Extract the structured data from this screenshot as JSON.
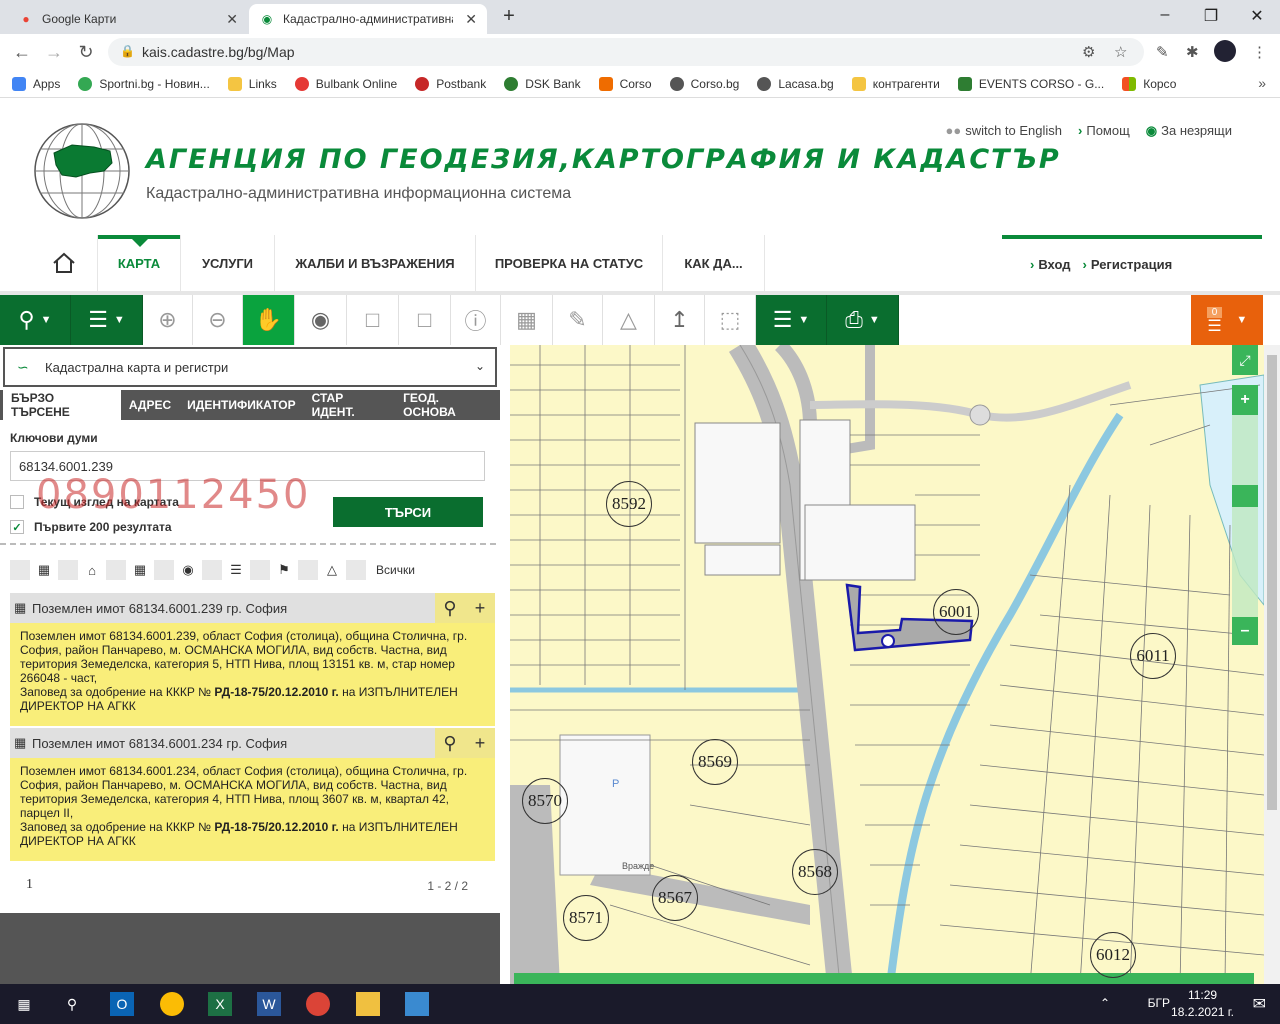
{
  "browser": {
    "tabs": [
      {
        "title": "Google Карти"
      },
      {
        "title": "Кадастрално-административна"
      }
    ],
    "url": "kais.cadastre.bg/bg/Map",
    "bookmarks": [
      {
        "label": "Apps",
        "color": "#4285f4"
      },
      {
        "label": "Sportni.bg - Новин...",
        "color": "#34a853"
      },
      {
        "label": "Links",
        "color": "#f4c542"
      },
      {
        "label": "Bulbank Online",
        "color": "#e53935"
      },
      {
        "label": "Postbank",
        "color": "#c62828"
      },
      {
        "label": "DSK Bank",
        "color": "#2e7d32"
      },
      {
        "label": "Corso",
        "color": "#ef6c00"
      },
      {
        "label": "Corso.bg",
        "color": "#555555"
      },
      {
        "label": "Lacasa.bg",
        "color": "#555555"
      },
      {
        "label": "контрагенти",
        "color": "#f4c542"
      },
      {
        "label": "EVENTS CORSO - G...",
        "color": "#2e7d32"
      },
      {
        "label": "Корсо",
        "color": "#f25022"
      }
    ]
  },
  "header": {
    "title": "АГЕНЦИЯ ПО ГЕОДЕЗИЯ,КАРТОГРАФИЯ И КАДАСТЪР",
    "subtitle": "Кадастрално-административна информационна система",
    "links": {
      "english": "switch to English",
      "help": "Помощ",
      "blind": "За незрящи"
    }
  },
  "menu": {
    "items": [
      "КАРТА",
      "УСЛУГИ",
      "ЖАЛБИ И ВЪЗРАЖЕНИЯ",
      "ПРОВЕРКА НА СТАТУС",
      "КАК ДА..."
    ],
    "login": "Вход",
    "register": "Регистрация"
  },
  "cart": {
    "count": "0"
  },
  "panel": {
    "layer": "Кадастрална карта и регистри",
    "tabs": [
      "БЪРЗО ТЪРСЕНЕ",
      "АДРЕС",
      "ИДЕНТИФИКАТОР",
      "СТАР ИДЕНТ.",
      "ГЕОД. ОСНОВА"
    ],
    "keywords_label": "Ключови думи",
    "keywords_value": "68134.6001.239",
    "watermark": "0890112450",
    "cb_current_view": "Текущ изглед на картата",
    "cb_first200": "Първите 200 резултата",
    "search_button": "ТЪРСИ",
    "filter_all": "Всички",
    "results": [
      {
        "title": "Поземлен имот 68134.6001.239 гр. София",
        "body": "Поземлен имот 68134.6001.239, област София (столица), община Столична, гр. София, район Панчарево, м. ОСМАНСКА МОГИЛА, вид собств. Частна, вид територия Земеделска, категория 5, НТП Нива, площ 13151 кв. м, стар номер 266048 - част,",
        "order_prefix": "Заповед за одобрение на КККР № ",
        "order_no": "РД-18-75/20.12.2010 г.",
        "order_suffix": " на ИЗПЪЛНИТЕЛЕН ДИРЕКТОР НА АГКК"
      },
      {
        "title": "Поземлен имот 68134.6001.234 гр. София",
        "body": "Поземлен имот 68134.6001.234, област София (столица), община Столична, гр. София, район Панчарево, м. ОСМАНСКА МОГИЛА, вид собств. Частна, вид територия Земеделска, категория 4, НТП Нива, площ 3607 кв. м, квартал 42, парцел II,",
        "order_prefix": "Заповед за одобрение на КККР № ",
        "order_no": "РД-18-75/20.12.2010 г.",
        "order_suffix": " на ИЗПЪЛНИТЕЛЕН ДИРЕКТОР НА АГКК"
      }
    ],
    "page": "1",
    "page_count": "1 - 2 / 2"
  },
  "map": {
    "labels": [
      "8592",
      "6001",
      "6011",
      "8569",
      "8570",
      "8568",
      "8567",
      "8571",
      "6012"
    ],
    "small_texts": [
      "Враждe",
      "P"
    ]
  },
  "taskbar": {
    "lang": "БГР",
    "time": "11:29",
    "date": "18.2.2021 г."
  }
}
